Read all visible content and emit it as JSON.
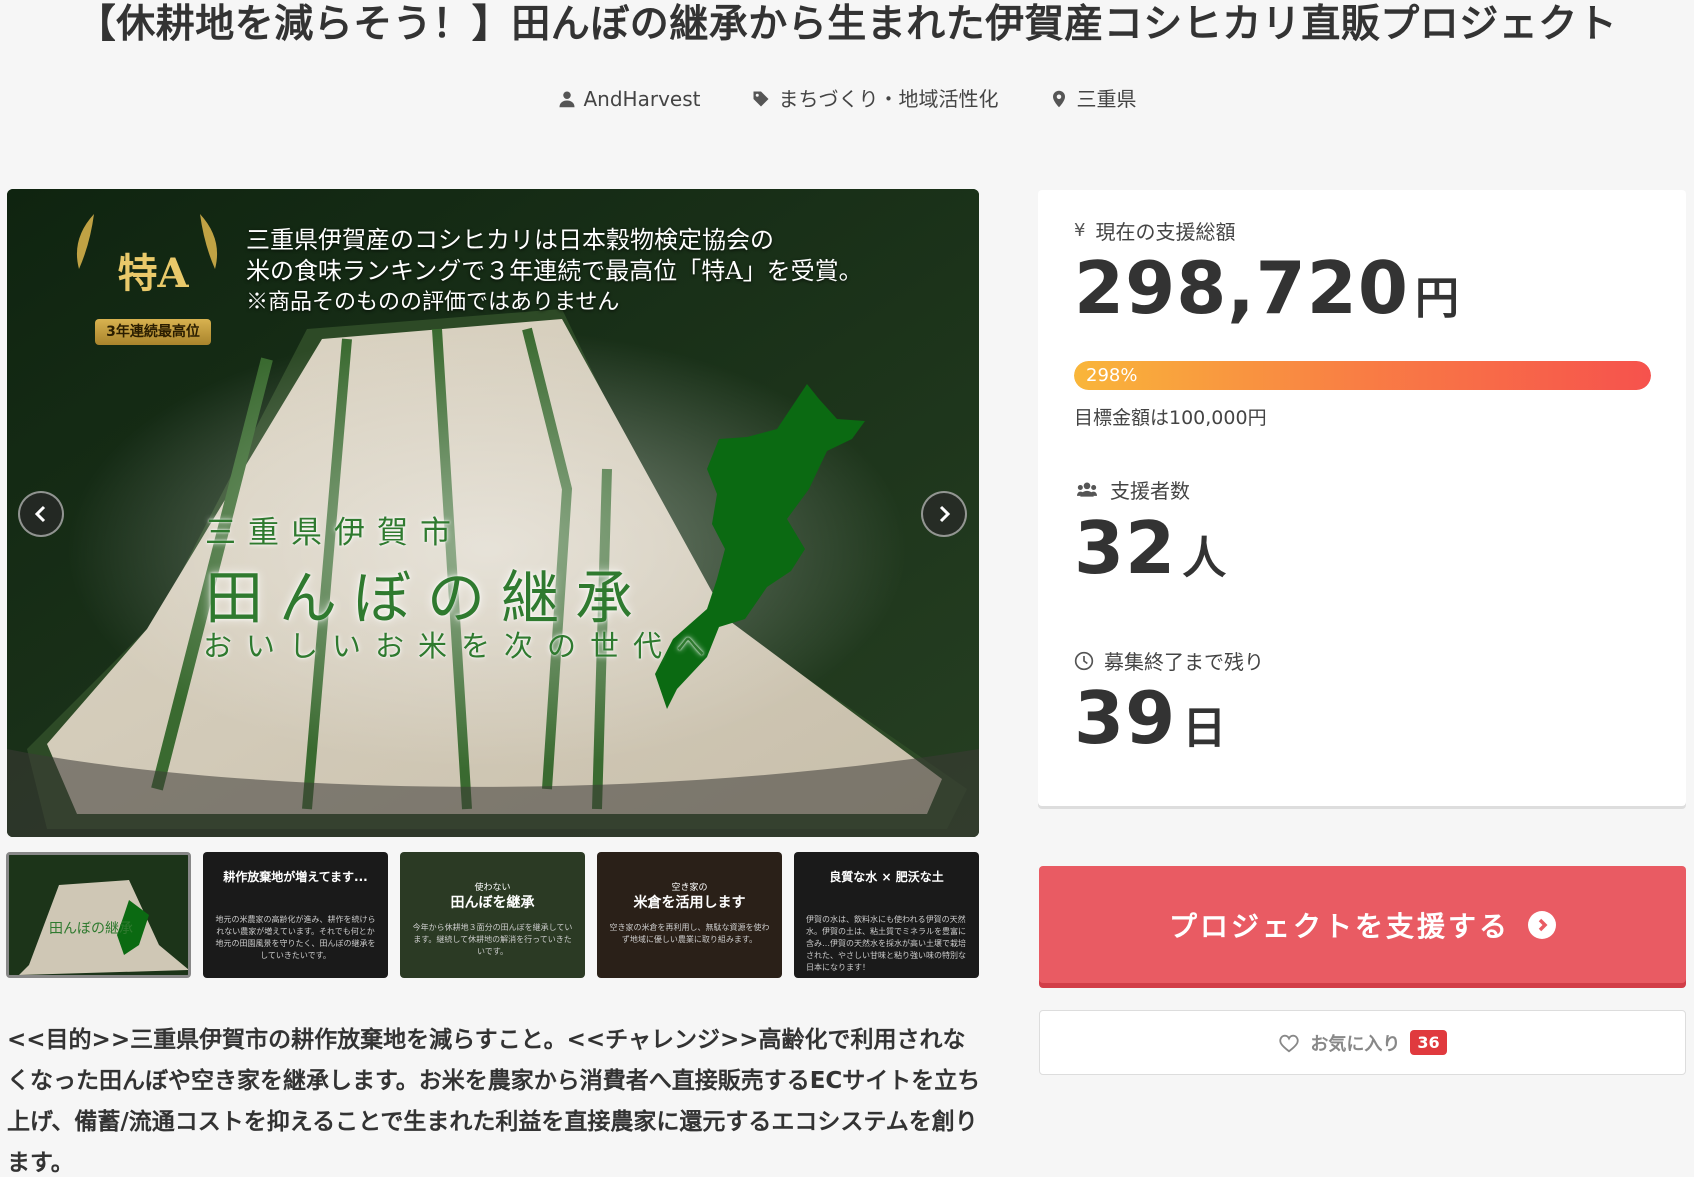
{
  "project": {
    "title": "【休耕地を減らそう！】田んぼの継承から生まれた伊賀産コシヒカリ直販プロジェクト",
    "owner": "AndHarvest",
    "category": "まちづくり・地域活性化",
    "location": "三重県"
  },
  "hero": {
    "badge_main": "特A",
    "badge_sub": "3年連続最高位",
    "text_line1": "三重県伊賀産のコシヒカリは日本穀物検定協会の",
    "text_line2": "米の食味ランキングで３年連続で最高位「特A」を受賞。",
    "text_line3": "※商品そのものの評価ではありません",
    "city": "三重県伊賀市",
    "main": "田んぼの継承",
    "sub": "おいしいお米を次の世代へ"
  },
  "thumbnails": [
    {
      "title": "",
      "big": "",
      "lines": ""
    },
    {
      "title": "耕作放棄地が増えてます...",
      "big": "",
      "lines": "地元の米農家の高齢化が進み、耕作を続けられない農家が増えています。それでも何とか地元の田園風景を守りたく、田んぼの継承をしていきたいです。"
    },
    {
      "title": "",
      "small": "使わない",
      "big": "田んぼを継承",
      "lines": "今年から休耕地３面分の田んぼを継承しています。継続して休耕地の解消を行っていきたいです。"
    },
    {
      "title": "",
      "small": "空き家の",
      "big": "米倉を活用します",
      "lines": "空き家の米倉を再利用し、無駄な資源を使わず地域に優しい農業に取り組みます。"
    },
    {
      "title": "良質な水 × 肥沃な土",
      "big": "",
      "lines": "伊賀の水は、飲料水にも使われる伊賀の天然水。伊賀の土は、粘土質でミネラルを豊富に含み…伊賀の天然水を採水が高い土壌で栽培された、やさしい甘味と粘り強い味の特別な日本になります！"
    }
  ],
  "description": "<<目的>>三重県伊賀市の耕作放棄地を減らすこと。<<チャレンジ>>高齢化で利用されなくなった田んぼや空き家を継承します。お米を農家から消費者へ直接販売するECサイトを立ち上げ、備蓄/流通コストを抑えることで生まれた利益を直接農家に還元するエコシステムを創ります。",
  "stats": {
    "amount_label": "現在の支援総額",
    "amount_value": "298,720",
    "amount_unit": "円",
    "progress_text": "298%",
    "progress_percent": 298,
    "goal_text": "目標金額は100,000円",
    "backers_label": "支援者数",
    "backers_value": "32",
    "backers_unit": "人",
    "remaining_label": "募集終了まで残り",
    "remaining_value": "39",
    "remaining_unit": "日"
  },
  "buttons": {
    "support": "プロジェクトを支援する",
    "favorite": "お気に入り",
    "favorite_count": "36"
  },
  "icons": {
    "owner": "user-icon",
    "category": "tag-icon",
    "location": "map-pin-icon",
    "amount": "yen-icon",
    "backers": "users-icon",
    "remaining": "clock-icon",
    "favorite": "heart-icon"
  },
  "colors": {
    "accent": "#e95b63",
    "progress_start": "#f9b63a",
    "progress_end": "#f6524d",
    "favorite_badge": "#e03a3e"
  }
}
